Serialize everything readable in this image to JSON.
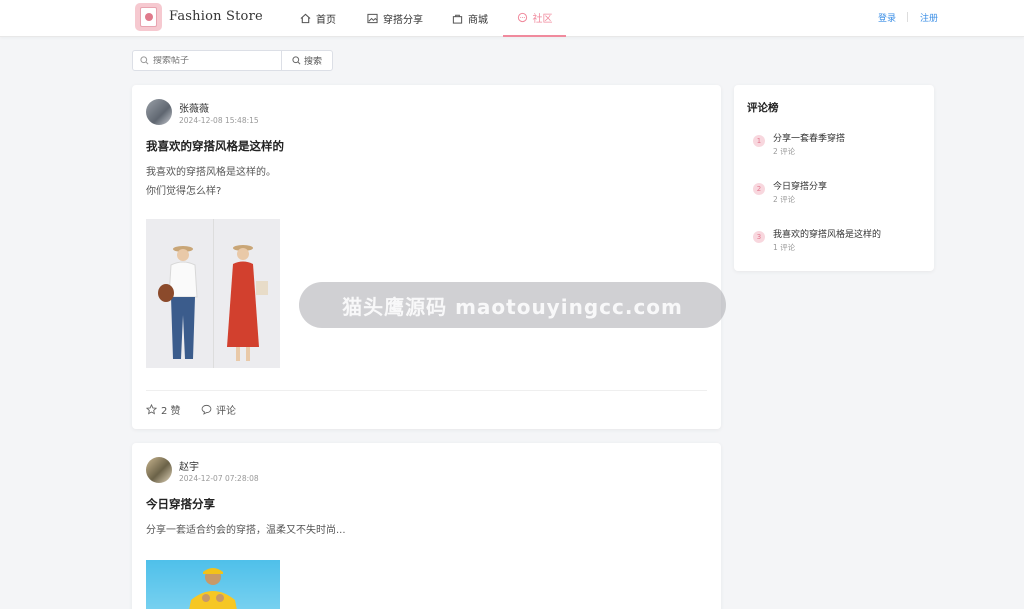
{
  "header": {
    "brand": "Fashion Store",
    "nav": [
      {
        "label": "首页",
        "icon": "home-icon"
      },
      {
        "label": "穿搭分享",
        "icon": "image-icon"
      },
      {
        "label": "商城",
        "icon": "bag-icon"
      },
      {
        "label": "社区",
        "icon": "chat-icon",
        "active": true
      }
    ],
    "login": "登录",
    "register": "注册"
  },
  "search": {
    "placeholder": "搜索帖子",
    "button": "搜索"
  },
  "posts": [
    {
      "author": "张薇薇",
      "date": "2024-12-08 15:48:15",
      "title": "我喜欢的穿搭风格是这样的",
      "body": "我喜欢的穿搭风格是这样的。\n你们觉得怎么样?",
      "likes": "2 赞",
      "comments": "评论"
    },
    {
      "author": "赵宇",
      "date": "2024-12-07 07:28:08",
      "title": "今日穿搭分享",
      "body": "分享一套适合约会的穿搭，温柔又不失时尚..."
    }
  ],
  "sidebar": {
    "title": "评论榜",
    "items": [
      {
        "rank": "1",
        "name": "分享一套春季穿搭",
        "count": "2 评论"
      },
      {
        "rank": "2",
        "name": "今日穿搭分享",
        "count": "2 评论"
      },
      {
        "rank": "3",
        "name": "我喜欢的穿搭风格是这样的",
        "count": "1 评论"
      }
    ]
  },
  "watermark": "猫头鹰源码 maotouyingcc.com",
  "colors": {
    "accent": "#f08a9d",
    "link": "#3a8ee6",
    "background": "#f4f5f7"
  }
}
